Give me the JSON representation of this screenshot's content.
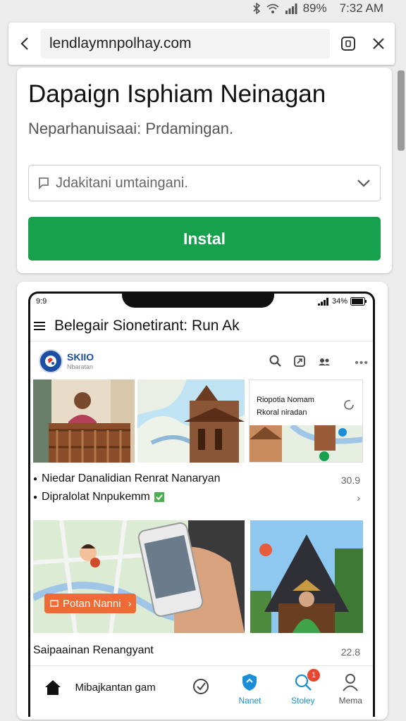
{
  "status_bar": {
    "battery": "89%",
    "time": "7:32 AM"
  },
  "browser": {
    "url": "lendlaymnpolhay.com"
  },
  "card": {
    "title": "Dapaign Isphiam Neinagan",
    "subtitle": "Neparhanuisaai: Prdamingan.",
    "dropdown_placeholder": "Jdakitani umtaingani.",
    "install_label": "Instal"
  },
  "phone": {
    "status_time": "9:9",
    "status_right": "34%",
    "title": "Belegair Sionetirant: Run Ak",
    "profile_name": "SKIIO",
    "profile_handle": "Nbaratan",
    "map_card_title": "Riopotia Nomam Rkoral niradan",
    "list1_item1": "Niedar Danalidian Renrat Nanaryan",
    "list1_item1_num": "30.9",
    "list1_item2": "Dipralolat Nnpukemm",
    "promo_label": "Potan Nanni",
    "list2_item1": "Saipaainan Renangyant",
    "list2_item1_num": "22.8",
    "bottom_nav": {
      "home_label": "Mibajkantan gam",
      "planet_label": "Nanet",
      "stoley_label": "Stoley",
      "menu_label": "Mema",
      "badge": "1"
    }
  },
  "colors": {
    "install_green": "#17a14c",
    "accent_blue": "#1a8fd8",
    "promo_orange": "#f06a35"
  }
}
